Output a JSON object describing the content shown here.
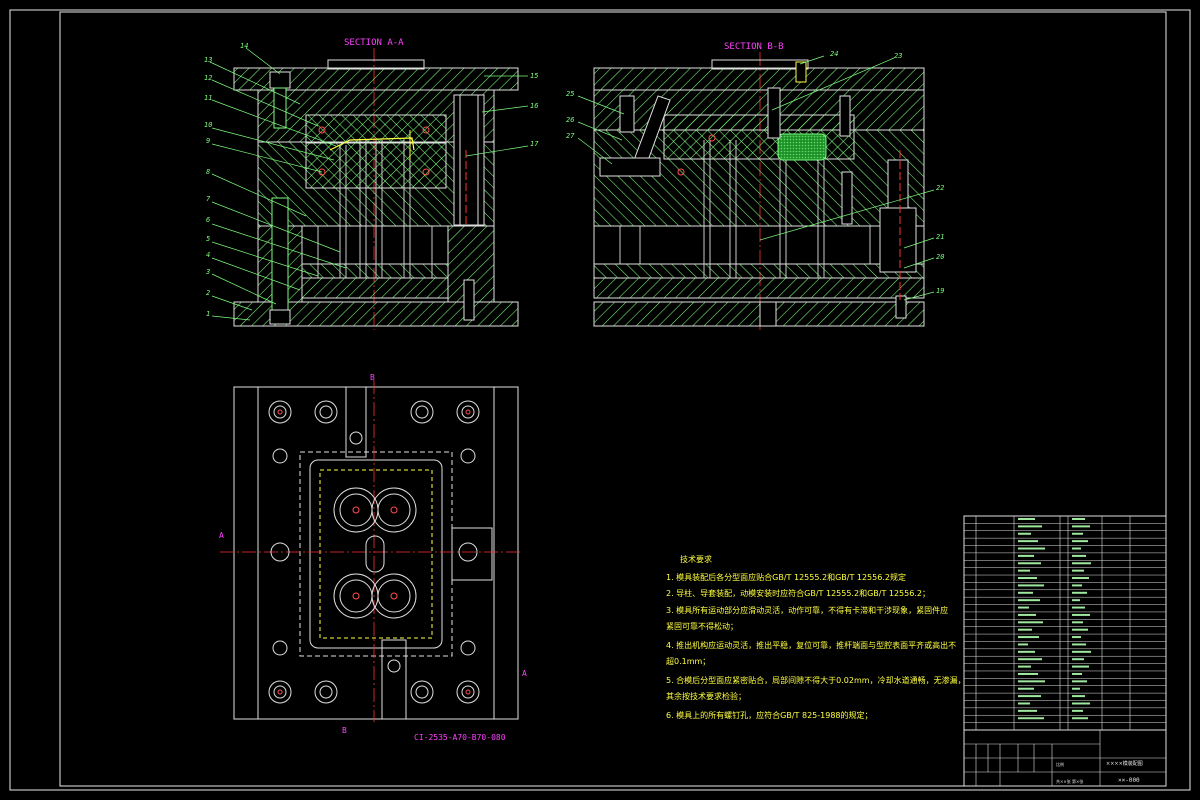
{
  "section_aa": {
    "title": "SECTION A-A"
  },
  "section_bb": {
    "title": "SECTION B-B"
  },
  "callouts_left": [
    "13",
    "12",
    "11",
    "10",
    "9",
    "8",
    "7",
    "6",
    "5",
    "4",
    "3",
    "2",
    "1"
  ],
  "callout_14": "14",
  "callout_15": "15",
  "callout_16": "16",
  "callout_17": "17",
  "callouts_bb_left": [
    "25",
    "26",
    "27"
  ],
  "callout_24": "24",
  "callout_23": "23",
  "callout_22": "22",
  "callout_21": "21",
  "callout_20": "20",
  "callout_19": "19",
  "plan_marks": {
    "a": "A",
    "b": "B"
  },
  "drawing_code": "CI-2535-A70-B70-080",
  "tech_notes": {
    "title": "技术要求",
    "lines": [
      "1. 模具装配后各分型面应贴合GB/T 12555.2和GB/T 12556.2规定",
      "2. 导柱、导套装配，动模安装时应符合GB/T 12555.2和GB/T 12556.2；",
      "3. 模具所有运动部分应滑动灵活，动作可靠，不得有卡滞和干涉现象，紧固件应",
      "   紧固可靠不得松动；",
      "4. 推出机构应运动灵活，推出平稳，复位可靠，推杆端面与型腔表面平齐或高出不",
      "   超0.1mm；",
      "5. 合模后分型面应紧密贴合，局部间隙不得大于0.02mm，冷却水道通畅，无渗漏，",
      "   其余按技术要求检验；",
      "6. 模具上的所有螺钉孔，应符合GB/T 825-1988的规定；"
    ]
  },
  "title_block": {
    "drawing_name": "××××模装配图",
    "drawing_no": "××-000",
    "scale_label": "比例",
    "sheet": "共××张 第×张"
  }
}
